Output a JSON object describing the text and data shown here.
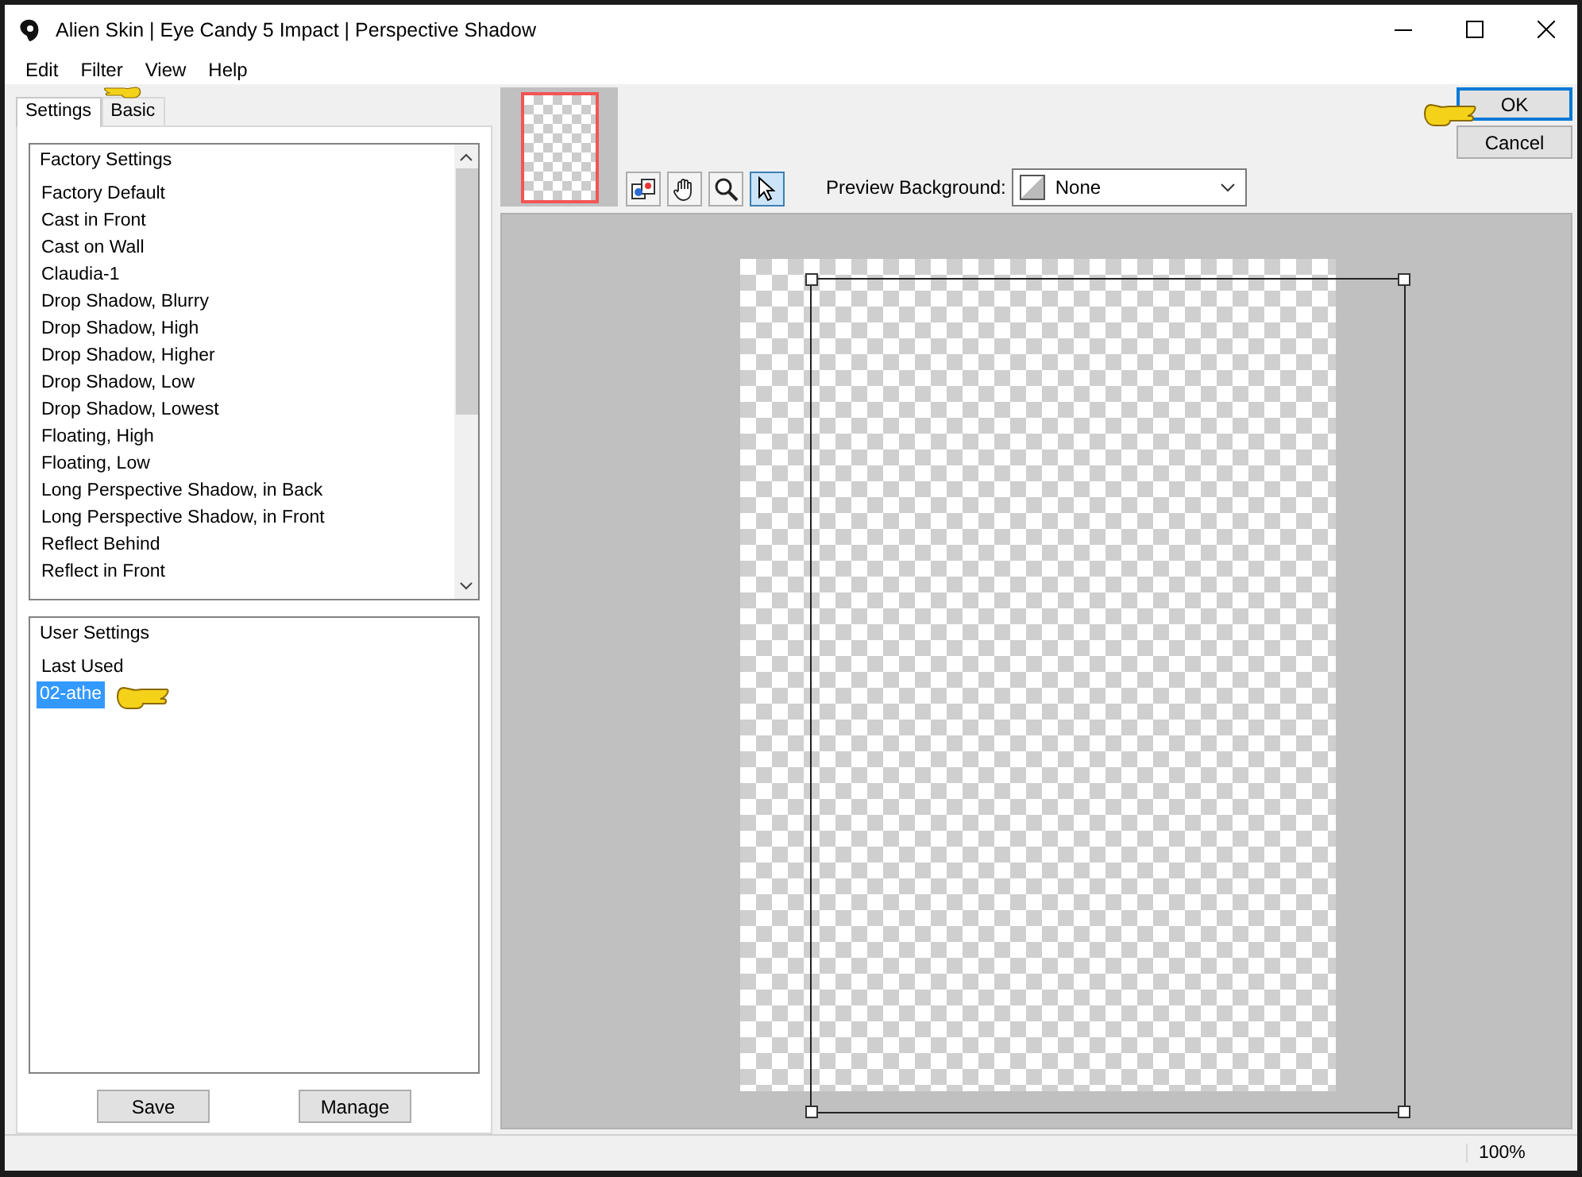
{
  "window": {
    "title": "Alien Skin | Eye Candy 5 Impact | Perspective Shadow"
  },
  "menu": [
    {
      "label": "Edit"
    },
    {
      "label": "Filter"
    },
    {
      "label": "View"
    },
    {
      "label": "Help"
    }
  ],
  "tabs": [
    {
      "label": "Settings",
      "selected": true
    },
    {
      "label": "Basic",
      "selected": false
    }
  ],
  "factory_settings": {
    "header": "Factory Settings",
    "items": [
      {
        "label": "Factory Default",
        "selected": false
      },
      {
        "label": "Cast in Front",
        "selected": false
      },
      {
        "label": "Cast on Wall",
        "selected": false
      },
      {
        "label": "Claudia-1",
        "selected": false
      },
      {
        "label": "Drop Shadow, Blurry",
        "selected": false
      },
      {
        "label": "Drop Shadow, High",
        "selected": false
      },
      {
        "label": "Drop Shadow, Higher",
        "selected": false
      },
      {
        "label": "Drop Shadow, Low",
        "selected": false
      },
      {
        "label": "Drop Shadow, Lowest",
        "selected": false
      },
      {
        "label": "Floating, High",
        "selected": false
      },
      {
        "label": "Floating, Low",
        "selected": false
      },
      {
        "label": "Long Perspective Shadow, in Back",
        "selected": false
      },
      {
        "label": "Long Perspective Shadow, in Front",
        "selected": false
      },
      {
        "label": "Reflect Behind",
        "selected": false
      },
      {
        "label": "Reflect in Front",
        "selected": false
      }
    ]
  },
  "user_settings": {
    "header": "User Settings",
    "items": [
      {
        "label": "Last Used",
        "selected": false
      },
      {
        "label": "02-athe",
        "selected": true
      }
    ]
  },
  "settings_buttons": [
    "Save",
    "Manage"
  ],
  "tools": [
    {
      "kind": "swap",
      "selected": false
    },
    {
      "kind": "hand",
      "selected": false
    },
    {
      "kind": "zoom",
      "selected": false
    },
    {
      "kind": "pointer",
      "selected": true
    }
  ],
  "preview_background": {
    "label": "Preview Background:",
    "value": "None"
  },
  "dialog_buttons": [
    {
      "label": "OK",
      "default": true
    },
    {
      "label": "Cancel",
      "default": false
    }
  ],
  "status_bar": {
    "zoom": "100%"
  }
}
